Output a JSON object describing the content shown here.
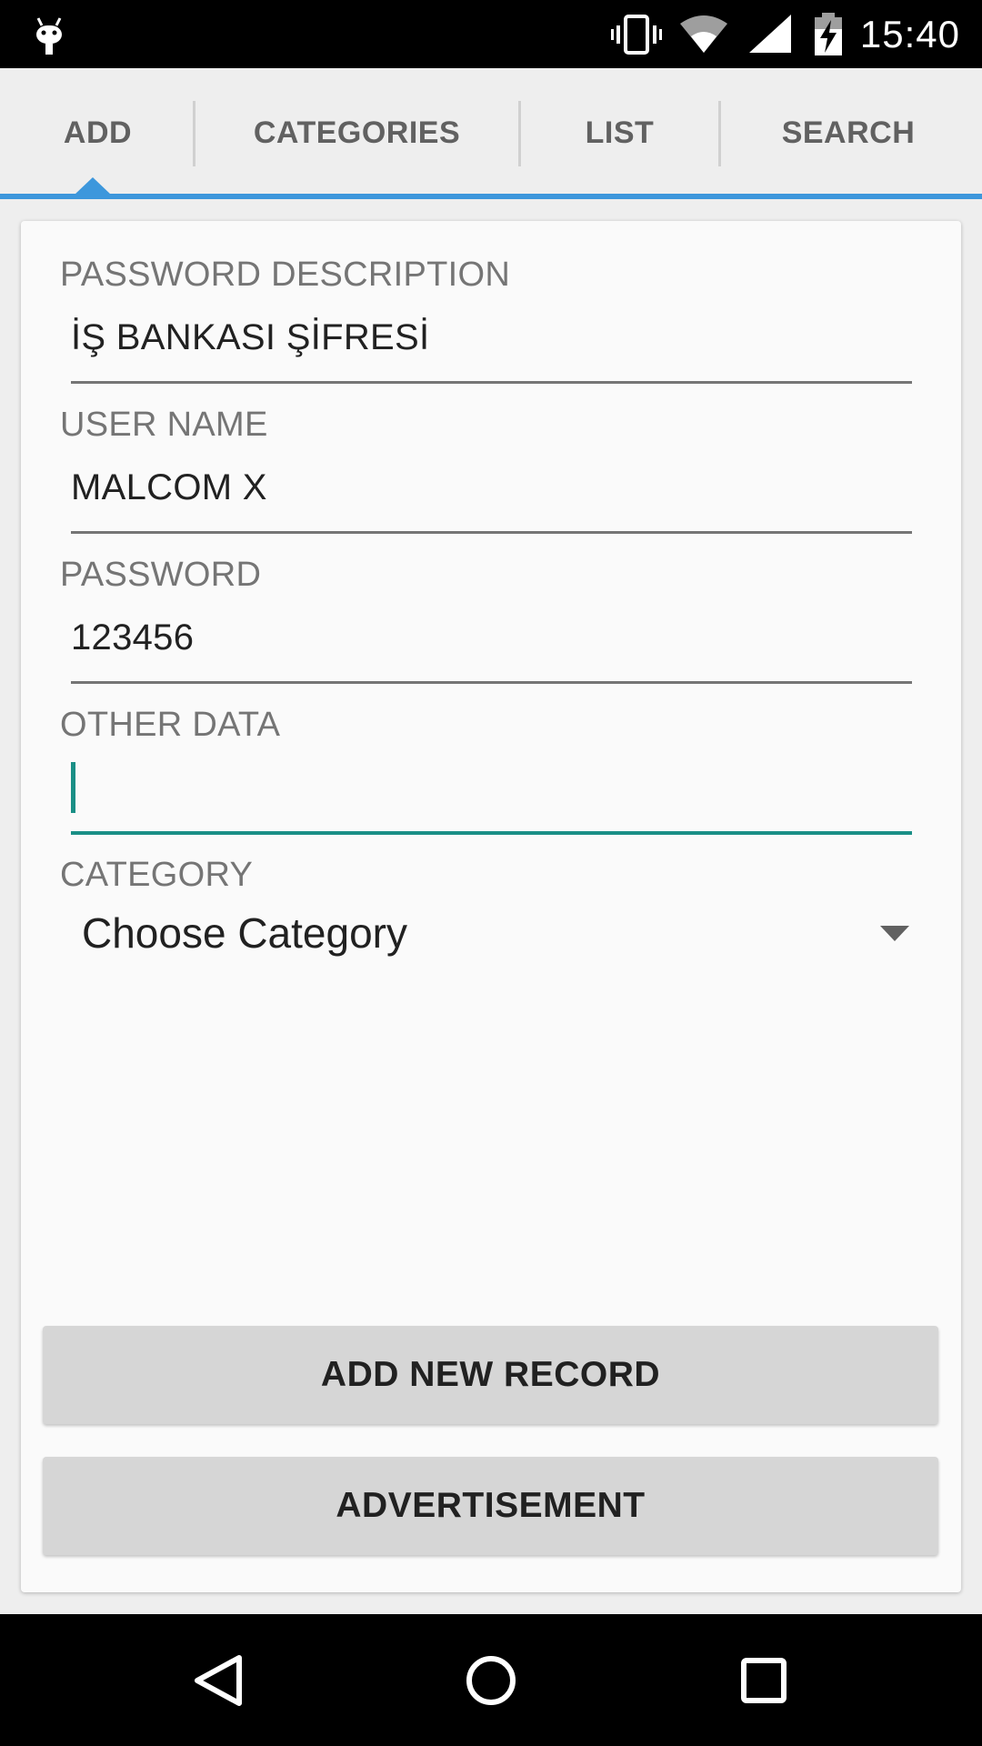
{
  "status_bar": {
    "time": "15:40",
    "icons": [
      "android-debug-icon",
      "vibrate-icon",
      "wifi-icon",
      "signal-icon",
      "battery-charging-icon"
    ]
  },
  "tabs": [
    {
      "label": "ADD",
      "selected": true
    },
    {
      "label": "CATEGORIES",
      "selected": false
    },
    {
      "label": "LIST",
      "selected": false
    },
    {
      "label": "SEARCH",
      "selected": false
    }
  ],
  "form": {
    "password_description": {
      "label": "PASSWORD DESCRIPTION",
      "value": "İŞ BANKASI ŞİFRESİ"
    },
    "user_name": {
      "label": "USER NAME",
      "value": "MALCOM X"
    },
    "password": {
      "label": "PASSWORD",
      "value": "123456"
    },
    "other_data": {
      "label": "OTHER DATA",
      "value": ""
    },
    "category": {
      "label": "CATEGORY",
      "selected": "Choose Category"
    }
  },
  "buttons": {
    "add_record": "ADD NEW RECORD",
    "advertisement": "ADVERTISEMENT"
  },
  "nav_bar": {
    "icons": [
      "back-icon",
      "home-icon",
      "recents-icon"
    ]
  },
  "colors": {
    "tab_accent": "#3d97dc",
    "focus_accent": "#1a8f86"
  }
}
